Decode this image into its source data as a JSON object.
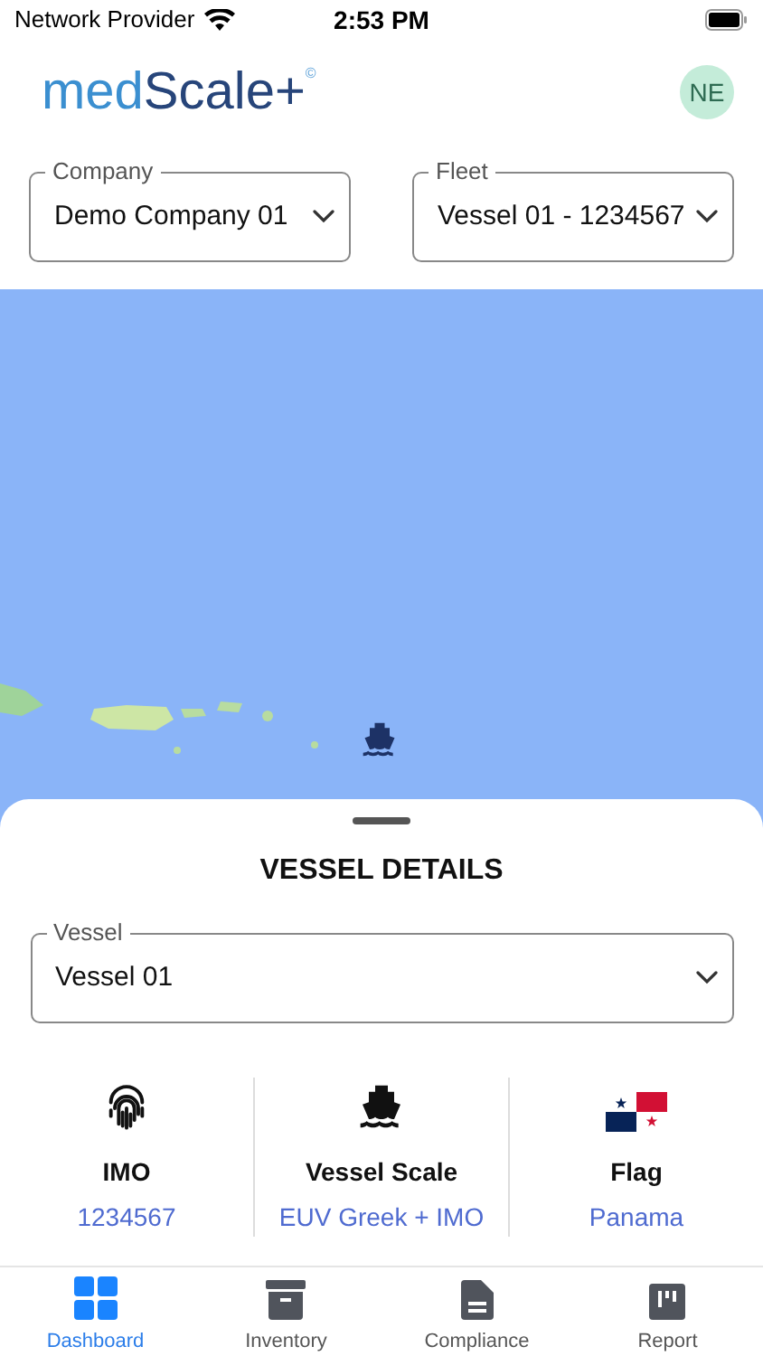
{
  "status_bar": {
    "carrier": "Network Provider",
    "time": "2:53 PM"
  },
  "header": {
    "logo": {
      "prefix": "med",
      "suffix": "Scale+",
      "mark": "©"
    },
    "avatar": "NE"
  },
  "filters": [
    {
      "label": "Company",
      "value": "Demo Company 01"
    },
    {
      "label": "Fleet",
      "value": "Vessel 01 - 1234567"
    }
  ],
  "sheet": {
    "title": "VESSEL DETAILS",
    "vessel_select": {
      "label": "Vessel",
      "value": "Vessel 01"
    },
    "details": [
      {
        "label": "IMO",
        "value": "1234567"
      },
      {
        "label": "Vessel Scale",
        "value": "EUV Greek + IMO"
      },
      {
        "label": "Flag",
        "value": "Panama"
      }
    ]
  },
  "tabs": [
    {
      "label": "Dashboard",
      "selected": true
    },
    {
      "label": "Inventory",
      "selected": false
    },
    {
      "label": "Compliance",
      "selected": false
    },
    {
      "label": "Report",
      "selected": false
    }
  ]
}
